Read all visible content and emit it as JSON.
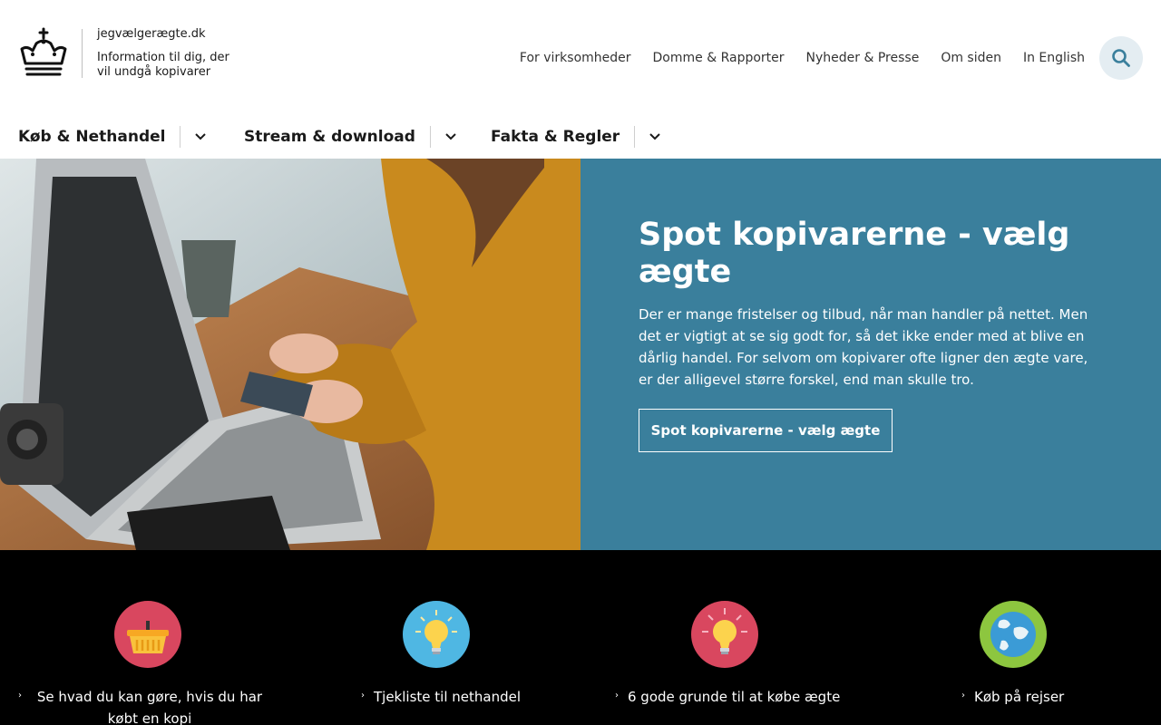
{
  "header": {
    "domain": "jegvælgerægte.dk",
    "tagline": "Information til dig, der vil undgå kopivarer",
    "top_links": [
      "For virksomheder",
      "Domme & Rapporter",
      "Nyheder & Presse",
      "Om siden",
      "In English"
    ],
    "search_icon": "search-icon"
  },
  "mainnav": {
    "items": [
      {
        "label": "Køb & Nethandel"
      },
      {
        "label": "Stream & download"
      },
      {
        "label": "Fakta & Regler"
      }
    ]
  },
  "hero": {
    "title": "Spot kopivarerne - vælg ægte",
    "text": "Der er mange fristelser og tilbud, når man handler på nettet. Men det er vigtigt at se sig godt for, så det ikke ender med at blive en dårlig handel. For selvom om kopivarer ofte ligner den ægte vare, er der alligevel større forskel, end man skulle tro.",
    "button": "Spot kopivarerne - vælg ægte"
  },
  "cards": [
    {
      "icon": "basket-icon",
      "color": "#d9475f",
      "label": "Se hvad du kan gøre, hvis du har købt en kopi"
    },
    {
      "icon": "lightbulb-icon",
      "color": "#4fb7e3",
      "label": "Tjekliste til nethandel"
    },
    {
      "icon": "lightbulb-icon",
      "color": "#d9475f",
      "label": "6 gode grunde til at købe ægte"
    },
    {
      "icon": "globe-icon",
      "color": "#8dc63f",
      "label": "Køb på rejser"
    }
  ],
  "colors": {
    "hero_panel": "#3a7f9c",
    "strip": "#000000",
    "search_bg": "#e4edf2"
  }
}
